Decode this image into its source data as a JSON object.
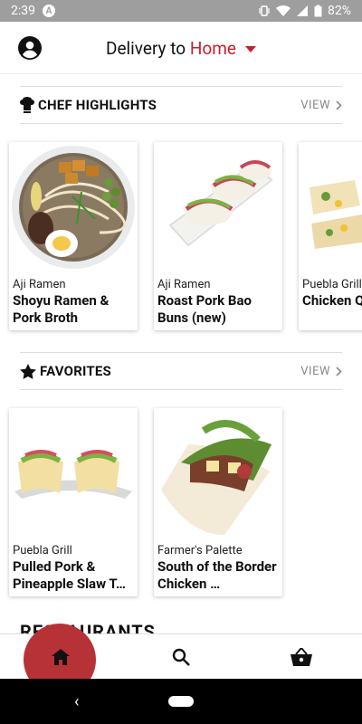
{
  "status": {
    "time": "2:39",
    "battery": "82%"
  },
  "header": {
    "prefix": "Delivery to ",
    "location": "Home"
  },
  "sections": {
    "chef": {
      "title": "CHEF HIGHLIGHTS",
      "view": "VIEW"
    },
    "favorites": {
      "title": "FAVORITES",
      "view": "VIEW"
    },
    "restaurants": {
      "title": "RESTAURANTS"
    }
  },
  "chef_cards": [
    {
      "restaurant": "Aji Ramen",
      "name": "Shoyu Ramen & Pork Broth"
    },
    {
      "restaurant": "Aji Ramen",
      "name": "Roast Pork Bao Buns (new)"
    },
    {
      "restaurant": "Puebla Grill",
      "name": "Chicken Quesadilla"
    }
  ],
  "favorite_cards": [
    {
      "restaurant": "Puebla Grill",
      "name": "Pulled Pork & Pineapple Slaw T…"
    },
    {
      "restaurant": "Farmer's Palette",
      "name": "South of the Border Chicken …"
    }
  ],
  "icons": {
    "profile": "account-circle-icon",
    "home": "home-icon",
    "search": "search-icon",
    "cart": "basket-icon"
  },
  "colors": {
    "accent": "#c6202e",
    "ripple": "#b73237",
    "status_bar": "#9e9e9e"
  }
}
